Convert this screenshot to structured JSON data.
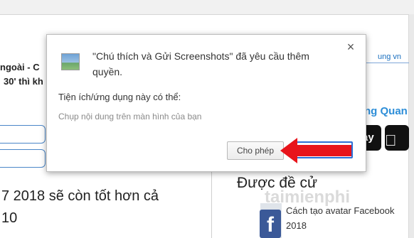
{
  "background": {
    "left_headline_1": "ngoài - C",
    "left_headline_2": "30' thì kh",
    "big_text_1": "7 2018 sẽ còn tốt hơn cả",
    "big_text_2": "10",
    "right_link_partial": "ung vn",
    "right_heading_partial": "ng Quan",
    "store_button_partial": "ay",
    "section_title": "Được đề cử",
    "article_title": "Cách tạo avatar Facebook 2018",
    "fb_letter": "f",
    "watermark": "taimienphi"
  },
  "dialog": {
    "title": "\"Chú thích và Gửi Screenshots\" đã yêu cầu thêm quyền.",
    "permission_label": "Tiện ích/ứng dụng này có thể:",
    "permission_item": "Chụp nội dung trên màn hình của bạn",
    "allow_button": "Cho phép",
    "close_glyph": "×"
  },
  "colors": {
    "arrow": "#e8141b",
    "accent_blue": "#2b6fd6",
    "facebook_blue": "#3b5998"
  }
}
